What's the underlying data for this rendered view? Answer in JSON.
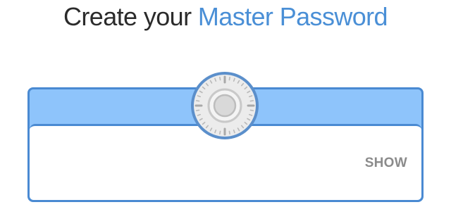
{
  "heading": {
    "prefix": "Create your ",
    "accent": "Master Password"
  },
  "password": {
    "value": "",
    "placeholder": "",
    "toggle_label": "SHOW"
  },
  "icons": {
    "vault": "vault-dial-icon"
  },
  "colors": {
    "accent": "#4a8fd6",
    "card_header": "#8ec4fb",
    "card_border": "#4a8ad2",
    "heading_text": "#2b2b2b",
    "toggle_text": "#8b8b8b"
  }
}
